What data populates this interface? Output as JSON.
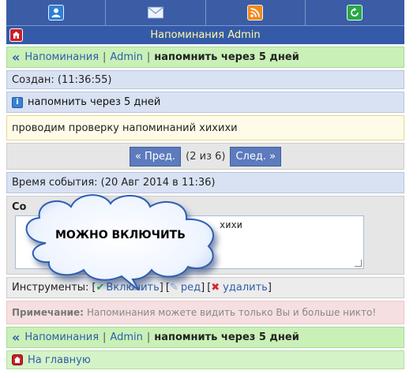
{
  "toolbar": {
    "icons": [
      "user-icon",
      "mail-icon",
      "rss-icon",
      "refresh-icon"
    ]
  },
  "header": {
    "title": "Напоминания Admin"
  },
  "breadcrumb": {
    "reminders": "Напоминания",
    "separator": "|",
    "user": "Admin",
    "current": "напомнить через 5 дней"
  },
  "created": {
    "text": "Создан: (11:36:55)"
  },
  "reminder_title": "напомнить через 5 дней",
  "reminder_body": "проводим проверку напоминаний хихихи",
  "pager": {
    "prev": "« Пред.",
    "count": "(2 из 6)",
    "next": "След. »"
  },
  "event_time": {
    "text": "Время события: (20 Авг 2014 в 11:36)"
  },
  "message": {
    "label_visible": "Со",
    "textarea_visible": "хихи"
  },
  "tools": {
    "label": "Инструменты:",
    "enable": "Включить",
    "edit": "ред",
    "delete": "удалить",
    "open": "[",
    "close": "]"
  },
  "note": {
    "label": "Примечание:",
    "text": "Напоминания можете видить только Вы и больше никто!"
  },
  "footer": {
    "home": "На главную"
  },
  "callout": {
    "text": "МОЖНО ВКЛЮЧИТЬ"
  },
  "colors": {
    "header_bg": "#355aa8",
    "header_text": "#fff9a6",
    "link": "#2f5ea8",
    "green_row": "#c9f0b7",
    "blue_row": "#d9e2f3",
    "pager_button": "#5d7bbd"
  }
}
